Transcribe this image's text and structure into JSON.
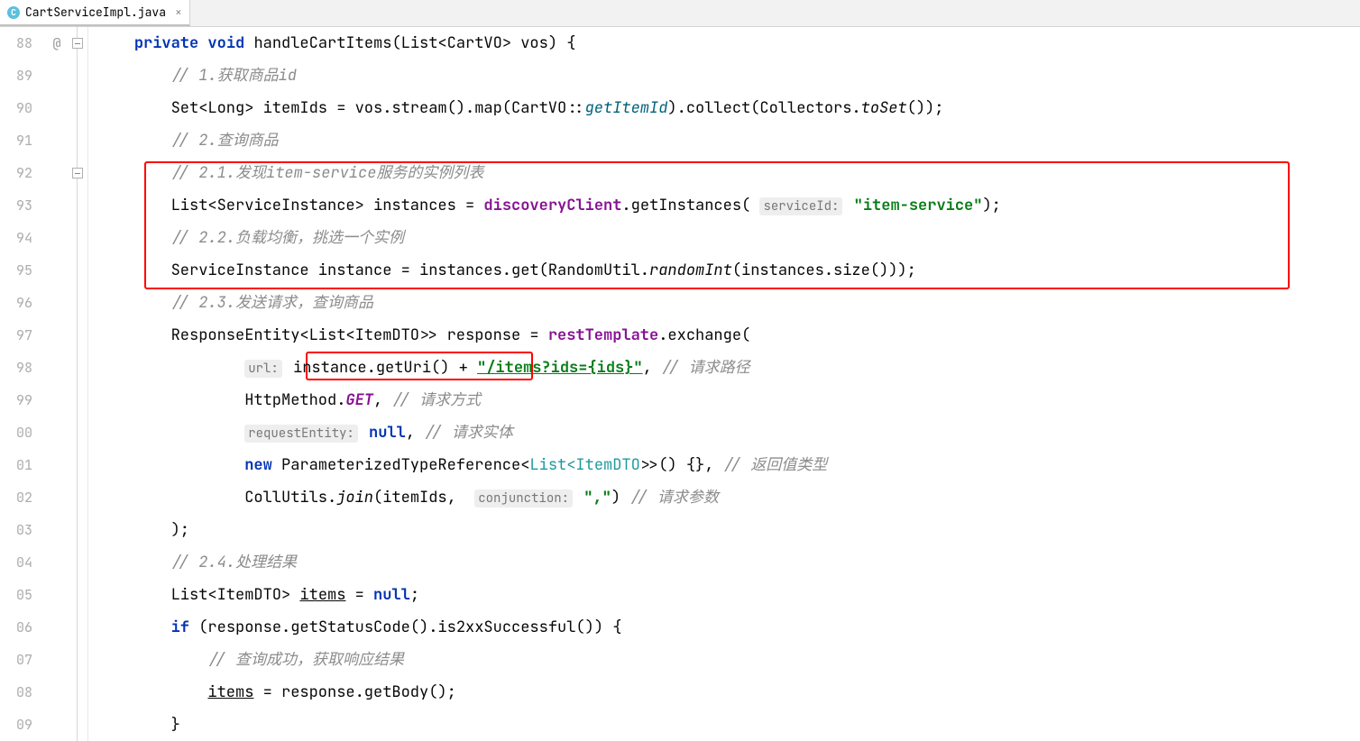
{
  "tab": {
    "filename": "CartServiceImpl.java",
    "icon_letter": "C"
  },
  "line_numbers": [
    "88",
    "89",
    "90",
    "91",
    "92",
    "93",
    "94",
    "95",
    "96",
    "97",
    "98",
    "99",
    "00",
    "01",
    "02",
    "03",
    "04",
    "05",
    "06",
    "07",
    "08",
    "09"
  ],
  "annotation_symbol": "@",
  "code": {
    "l88": {
      "kw1": "private",
      "kw2": "void",
      "method": "handleCartItems",
      "params": "(List<CartVO> vos) {"
    },
    "l89_comment": "// 1.获取商品id",
    "l90": {
      "text1": "Set<Long> itemIds = vos.stream().map(CartVO::",
      "method1": "getItemId",
      "text2": ").collect(Collectors.",
      "static1": "toSet",
      "text3": "());"
    },
    "l91_comment": "// 2.查询商品",
    "l92_comment": "// 2.1.发现item-service服务的实例列表",
    "l93": {
      "text1": "List<ServiceInstance> instances = ",
      "field1": "discoveryClient",
      "text2": ".getInstances(",
      "hint": "serviceId:",
      "string": "\"item-service\"",
      "text3": ");"
    },
    "l94_comment": "// 2.2.负载均衡，挑选一个实例",
    "l95": {
      "text1": "ServiceInstance instance = instances.get(RandomUtil.",
      "static1": "randomInt",
      "text2": "(instances.size()));"
    },
    "l96_comment": "// 2.3.发送请求，查询商品",
    "l97": {
      "text1": "ResponseEntity<List<ItemDTO>> response = ",
      "field1": "restTemplate",
      "text2": ".exchange("
    },
    "l98": {
      "hint": "url:",
      "text1": "instance.getUri()",
      "text2": " + ",
      "string": "\"/items?ids={ids}\"",
      "text3": ", ",
      "comment": "// 请求路径"
    },
    "l99": {
      "text1": "HttpMethod.",
      "field1": "GET",
      "text2": ", ",
      "comment": "// 请求方式"
    },
    "l100": {
      "hint": "requestEntity:",
      "kw": "null",
      "text": ", ",
      "comment": "// 请求实体"
    },
    "l101": {
      "kw": "new",
      "text1": " ParameterizedTypeReference<",
      "type": "List<ItemDTO>",
      "text2": ">() {}, ",
      "comment": "// 返回值类型"
    },
    "l102": {
      "text1": "CollUtils.",
      "static1": "join",
      "text2": "(itemIds, ",
      "hint": "conjunction:",
      "string": "\",\"",
      "text3": ") ",
      "comment": "// 请求参数"
    },
    "l103": ");",
    "l104_comment": "// 2.4.处理结果",
    "l105": {
      "text1": "List<ItemDTO> ",
      "var": "items",
      "text2": " = ",
      "kw": "null",
      "text3": ";"
    },
    "l106": {
      "kw": "if",
      "text": " (response.getStatusCode().is2xxSuccessful()) {"
    },
    "l107_comment": "// 查询成功，获取响应结果",
    "l108": {
      "var": "items",
      "text": " = response.getBody();"
    },
    "l109": "}"
  }
}
